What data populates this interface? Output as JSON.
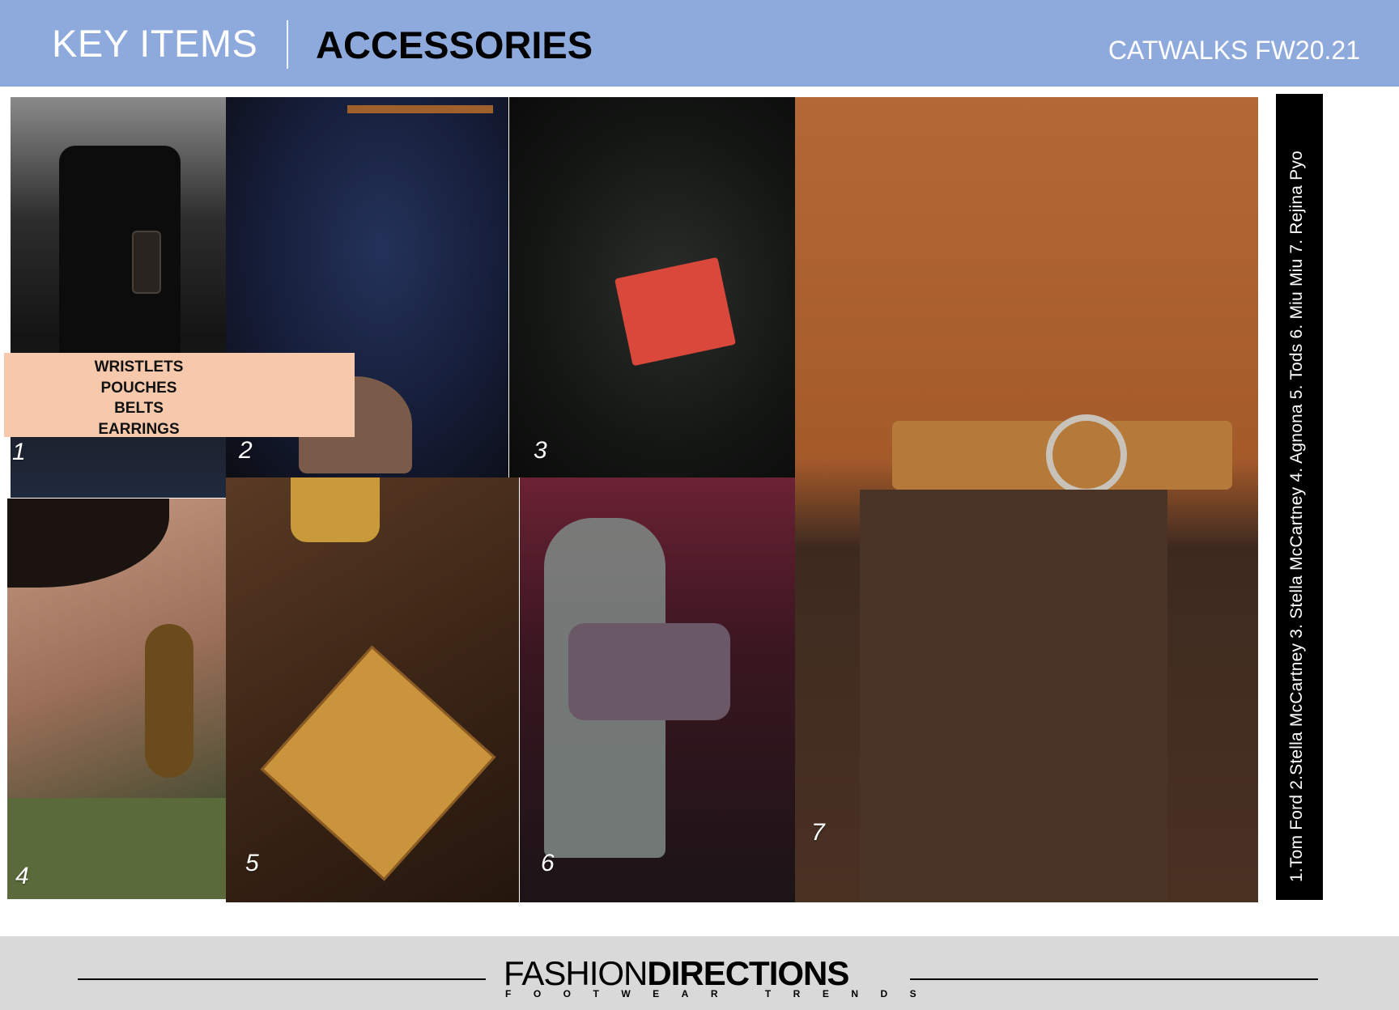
{
  "header": {
    "title_left": "KEY ITEMS",
    "title_main": "ACCESSORIES",
    "season": "CATWALKS FW20.21"
  },
  "label_box": {
    "items": [
      "WRISTLETS",
      "POUCHES",
      "BELTS",
      "EARRINGS"
    ]
  },
  "tiles": [
    {
      "number": "1"
    },
    {
      "number": "2"
    },
    {
      "number": "3"
    },
    {
      "number": "4"
    },
    {
      "number": "5"
    },
    {
      "number": "6"
    },
    {
      "number": "7"
    }
  ],
  "credits": "1.Tom Ford  2.Stella McCartney  3. Stella McCartney  4. Agnona  5. Tods  6. Miu Miu  7. Rejina Pyo",
  "footer": {
    "brand_light": "FASHION",
    "brand_bold": "DIRECTIONS",
    "tagline": "FOOTWEAR TRENDS"
  },
  "colors": {
    "header_bg": "#8ea9db",
    "label_bg": "#f7c9ac",
    "footer_bg": "#d9d9d9",
    "credits_bg": "#000000"
  }
}
